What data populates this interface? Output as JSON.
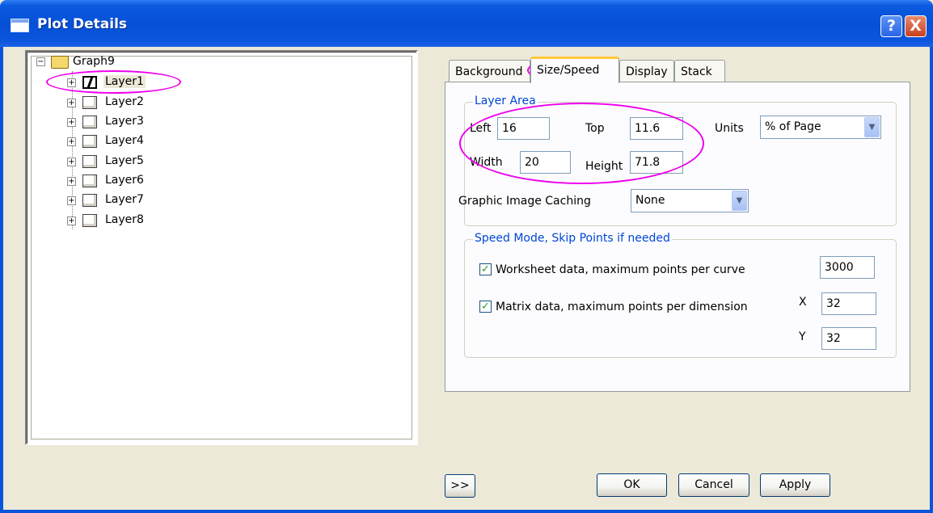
{
  "window": {
    "title": "Plot Details",
    "help_label": "?",
    "close_label": "X"
  },
  "tree": {
    "root": "Graph9",
    "items": [
      "Layer1",
      "Layer2",
      "Layer3",
      "Layer4",
      "Layer5",
      "Layer6",
      "Layer7",
      "Layer8"
    ],
    "selected": "Layer1"
  },
  "tabs": {
    "background": "Background",
    "size_speed": "Size/Speed",
    "display": "Display",
    "stack": "Stack",
    "active": "Size/Speed"
  },
  "layer_area": {
    "legend": "Layer Area",
    "left_label": "Left",
    "left_value": "16",
    "top_label": "Top",
    "top_value": "11.6",
    "width_label": "Width",
    "width_value": "20",
    "height_label": "Height",
    "height_value": "71.8",
    "units_label": "Units",
    "units_value": "% of Page",
    "caching_label": "Graphic Image Caching",
    "caching_value": "None"
  },
  "speed_mode": {
    "legend": "Speed Mode, Skip Points if needed",
    "worksheet_label": "Worksheet data, maximum points per curve",
    "worksheet_checked": true,
    "worksheet_value": "3000",
    "matrix_label": "Matrix data, maximum points per dimension",
    "matrix_checked": true,
    "x_label": "X",
    "x_value": "32",
    "y_label": "Y",
    "y_value": "32"
  },
  "buttons": {
    "expand": ">>",
    "ok": "OK",
    "cancel": "Cancel",
    "apply": "Apply"
  },
  "annotation_color": "#ee00ee",
  "accent_color": "#0046d5"
}
